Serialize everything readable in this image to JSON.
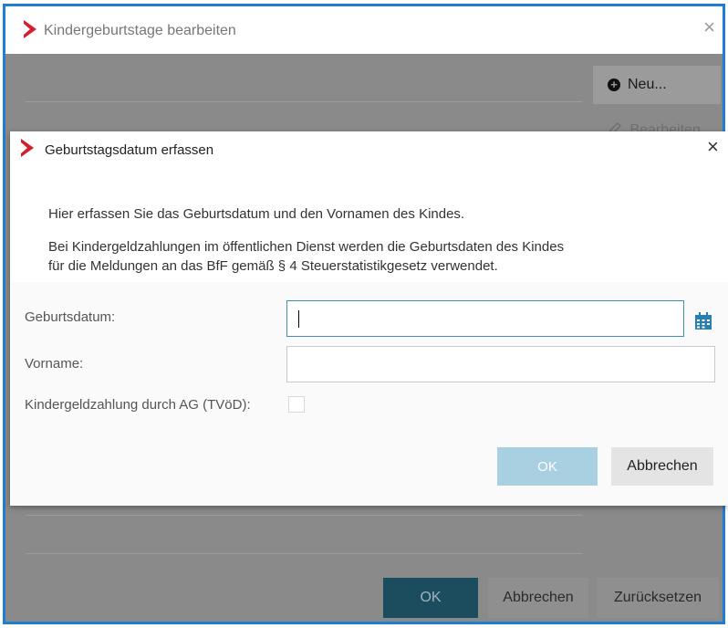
{
  "outer_window": {
    "title": "Kindergeburtstage bearbeiten",
    "close_glyph": "×",
    "new_button_label": "Neu...",
    "new_button_icon": "plus-circle-icon",
    "edit_button_label": "Bearbeiten",
    "edit_button_icon": "pencil-icon",
    "footer": {
      "ok_label": "OK",
      "cancel_label": "Abbrechen",
      "reset_label": "Zurücksetzen"
    }
  },
  "dialog": {
    "title": "Geburtstagsdatum erfassen",
    "close_glyph": "×",
    "intro_line1": "Hier erfassen Sie das Geburtsdatum und den Vornamen des Kindes.",
    "intro_line2": "Bei Kindergeldzahlungen im öffentlichen Dienst werden die Geburtsdaten des Kindes",
    "intro_line3": "für die Meldungen an das BfF gemäß § 4 Steuerstatistikgesetz verwendet.",
    "fields": {
      "birthdate_label": "Geburtsdatum:",
      "birthdate_value": "",
      "firstname_label": "Vorname:",
      "firstname_value": "",
      "child_benefit_label": "Kindergeldzahlung durch AG (TVöD):",
      "child_benefit_checked": false
    },
    "ok_label": "OK",
    "cancel_label": "Abbrechen"
  },
  "colors": {
    "brand_red": "#d0202f",
    "window_border": "#1e7fd0",
    "primary_dark": "#1b4d5e",
    "primary_disabled": "#a8d0e0",
    "calendar_icon": "#2a7fb0"
  }
}
